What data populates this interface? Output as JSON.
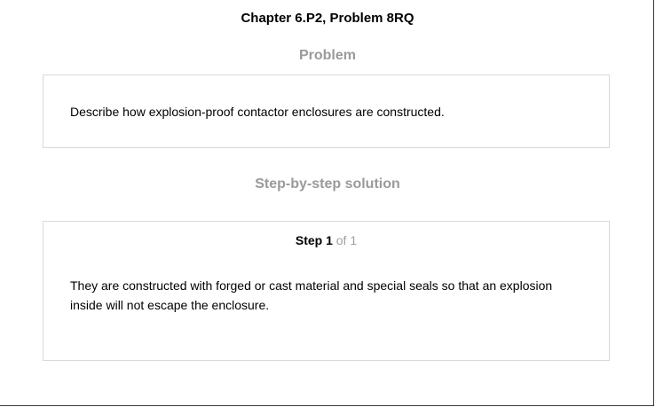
{
  "page": {
    "title": "Chapter 6.P2, Problem 8RQ"
  },
  "problem": {
    "heading": "Problem",
    "text": "Describe how explosion-proof contactor enclosures are constructed."
  },
  "solution": {
    "heading": "Step-by-step solution",
    "step": {
      "word": "Step 1",
      "of": " of 1"
    },
    "text": "They are constructed with forged or cast material and special seals so that an explosion inside will not escape the enclosure."
  }
}
